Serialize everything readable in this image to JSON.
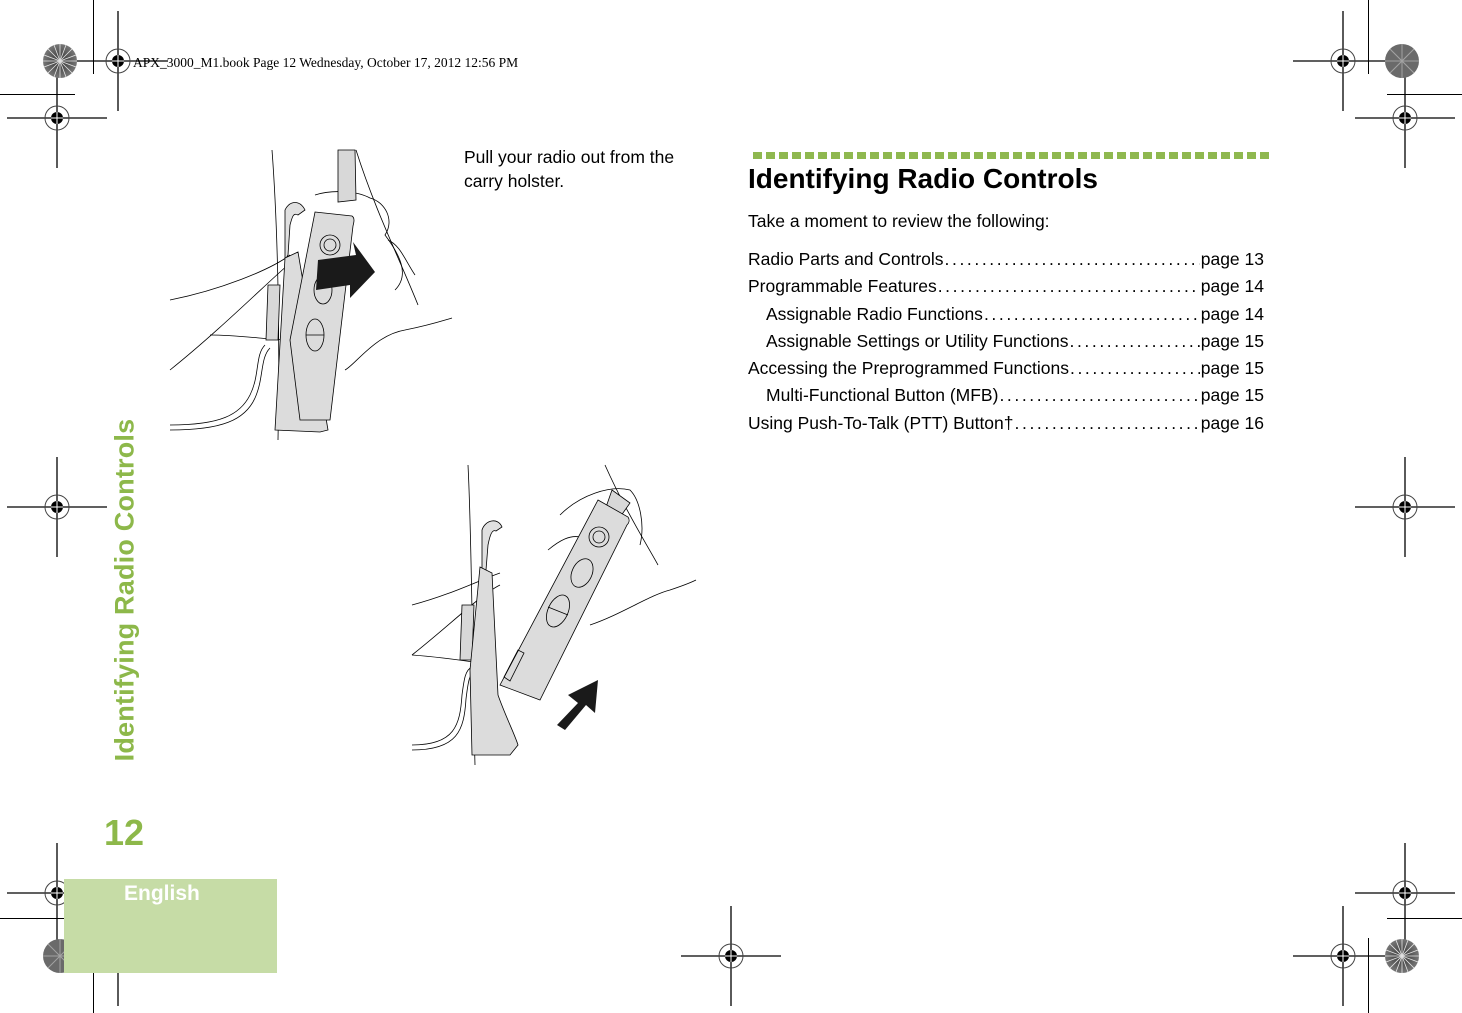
{
  "slug": "APX_3000_M1.book  Page 12  Wednesday, October 17, 2012  12:56 PM",
  "sidebar": {
    "chapter_title": "Identifying Radio Controls",
    "page_number": "12",
    "language_tab": "English"
  },
  "left_column": {
    "caption": "Pull your radio out from the carry holster.",
    "illustrations": [
      {
        "name": "radio-in-holster",
        "arrow_direction": "right"
      },
      {
        "name": "radio-pulled-out",
        "arrow_direction": "up-right"
      }
    ]
  },
  "right_column": {
    "section_title": "Identifying Radio Controls",
    "intro": "Take a moment to review the following:",
    "toc": [
      {
        "label": "Radio Parts and Controls",
        "page": "page 13",
        "level": 1
      },
      {
        "label": "Programmable Features",
        "page": "page 14",
        "level": 1
      },
      {
        "label": "Assignable Radio Functions",
        "page": "page 14",
        "level": 2
      },
      {
        "label": "Assignable Settings or Utility Functions",
        "page": "page 15",
        "level": 2
      },
      {
        "label": "Accessing the Preprogrammed Functions",
        "page": "page 15",
        "level": 1
      },
      {
        "label": "Multi-Functional Button (MFB)",
        "page": "page 15",
        "level": 2
      },
      {
        "label": "Using Push-To-Talk (PTT) Button†",
        "page": "page 16",
        "level": 1
      }
    ]
  },
  "colors": {
    "accent_green": "#8db84a",
    "tab_green": "#c6dca6",
    "device_gray": "#dcdcdc"
  }
}
